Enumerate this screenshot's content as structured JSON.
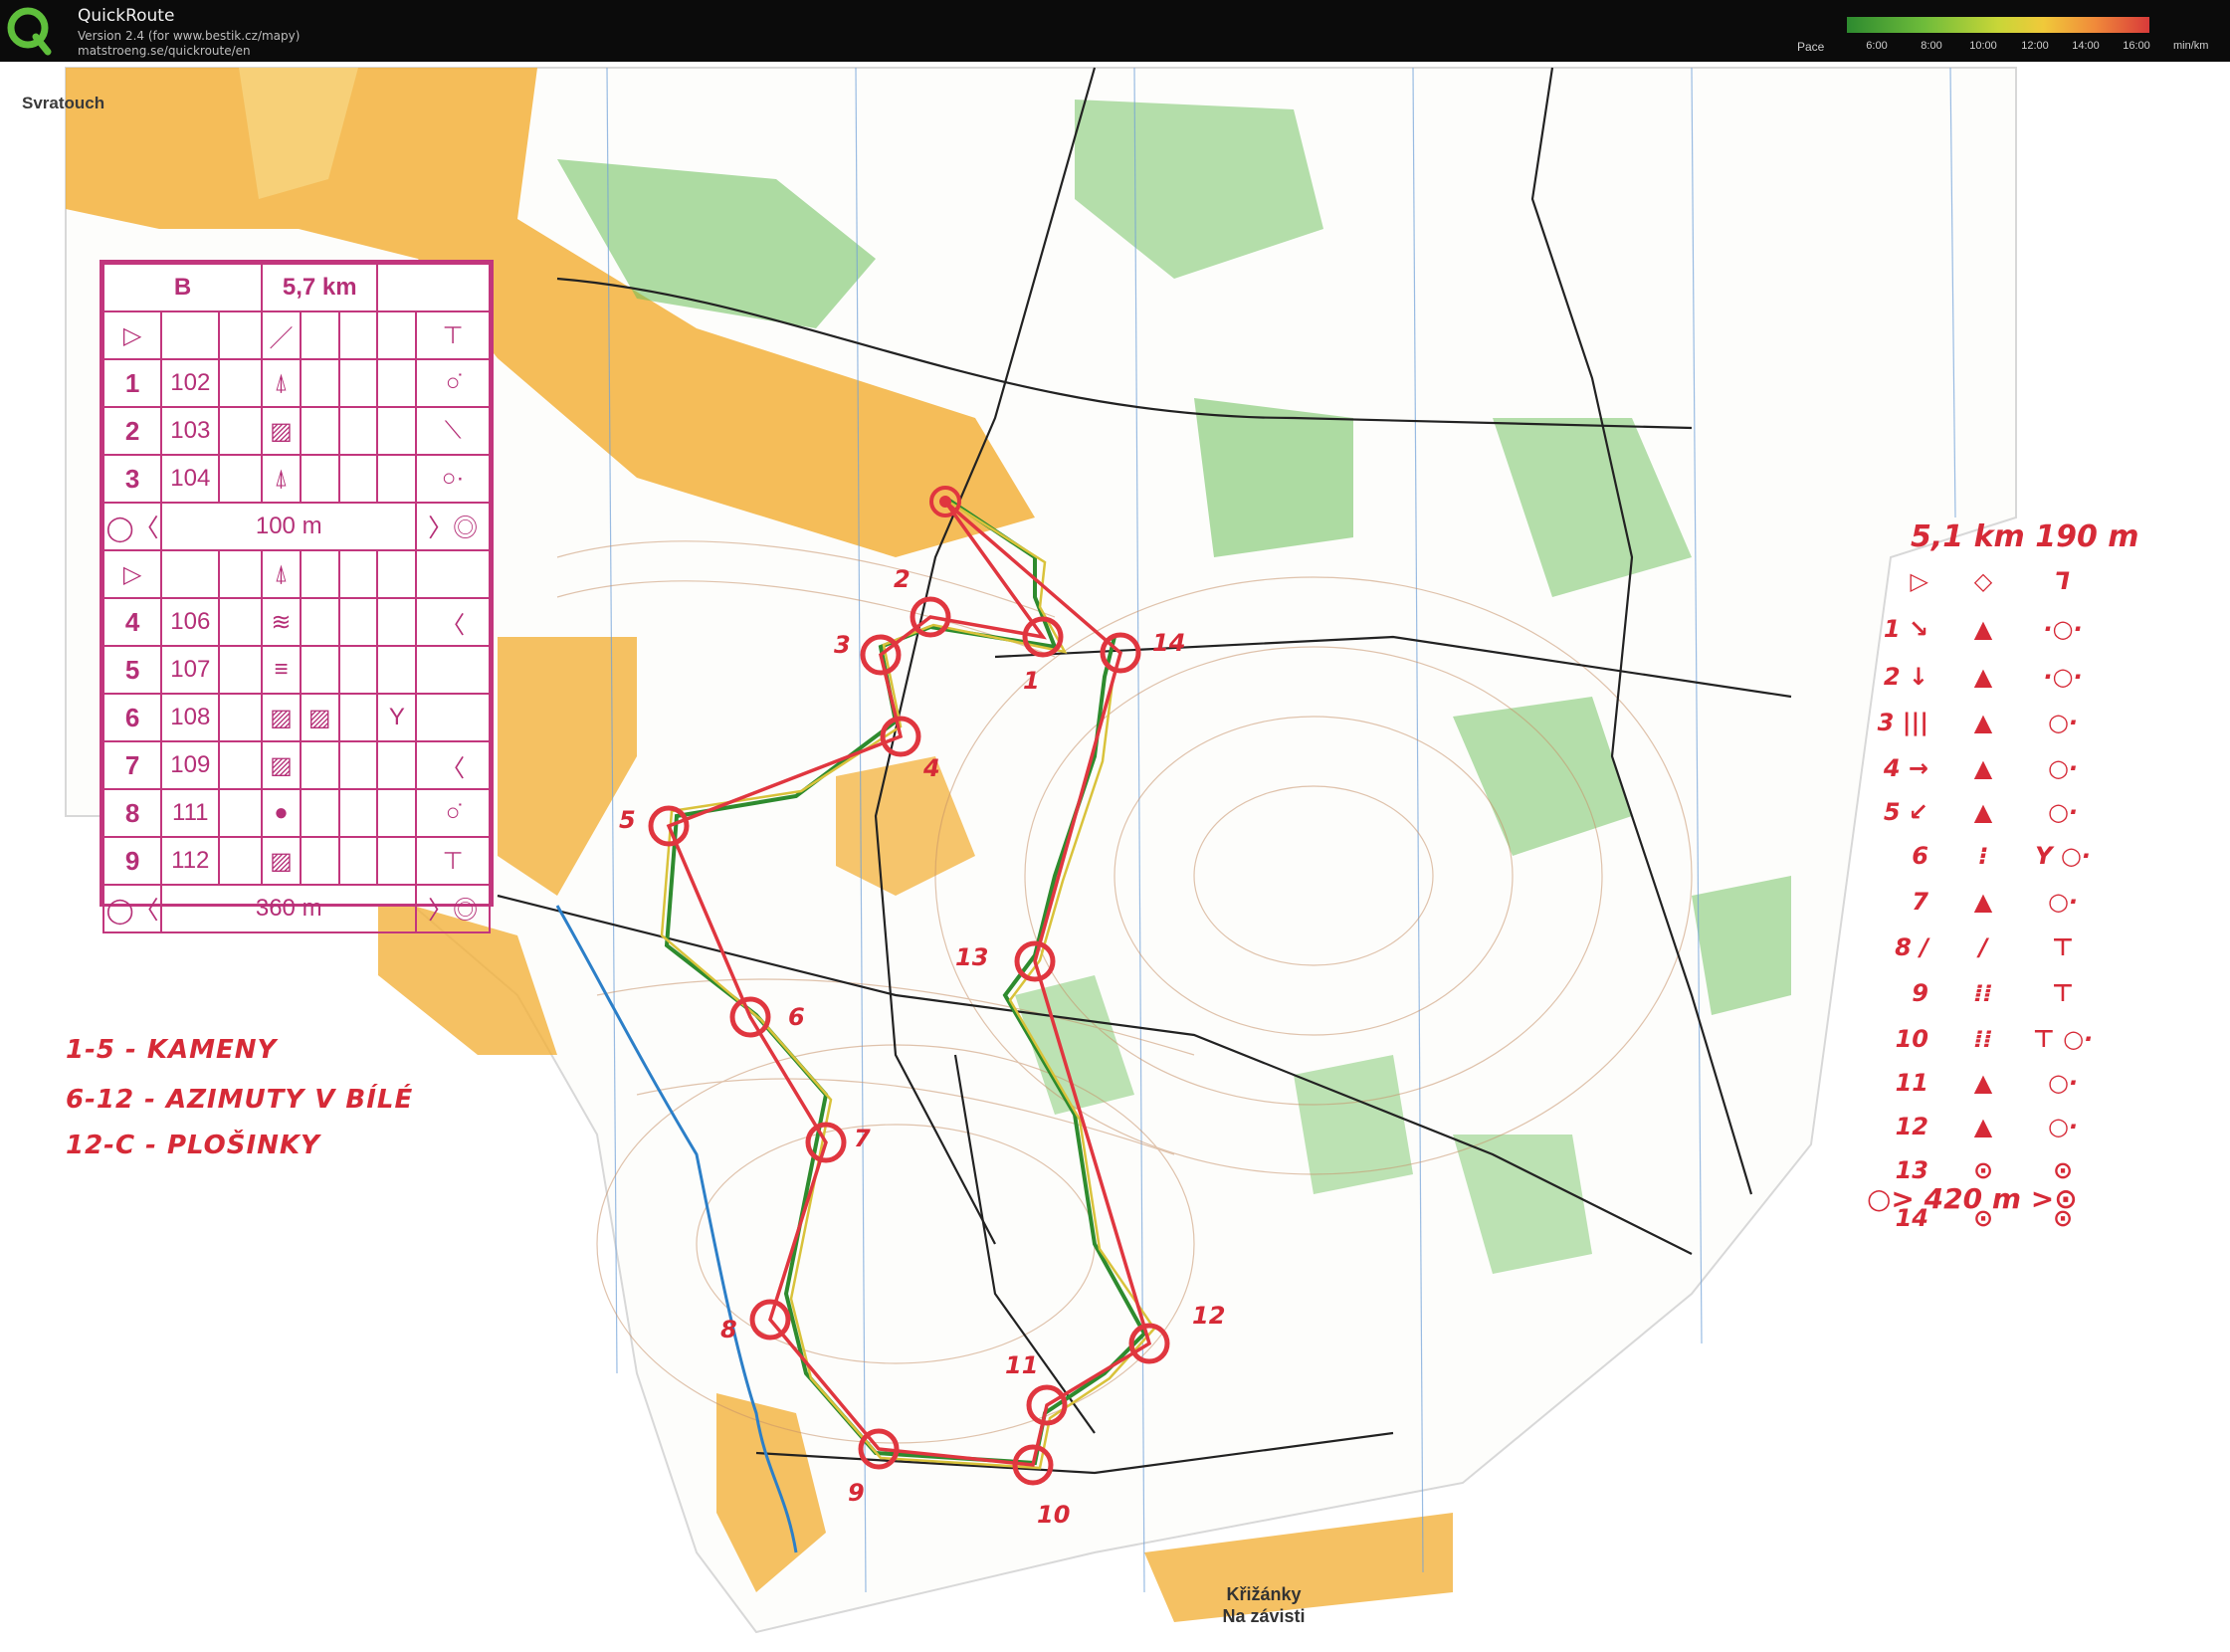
{
  "header": {
    "app_name": "QuickRoute",
    "version": "Version 2.4  (for www.bestik.cz/mapy)",
    "url": "matstroeng.se/quickroute/en",
    "pace_label": "Pace",
    "pace_ticks": [
      "6:00",
      "8:00",
      "10:00",
      "12:00",
      "14:00",
      "16:00"
    ],
    "pace_unit": "min/km",
    "pace_gradient": [
      "#2d8a2f",
      "#6dbb3a",
      "#c8d638",
      "#f0c93a",
      "#f08a3a",
      "#d83a3a"
    ]
  },
  "map": {
    "title": "Svratouch",
    "bottom_label_1": "Křižánky",
    "bottom_label_2": "Na závisti",
    "route_colors": {
      "planned": "#e0363f",
      "gps_green": "#2e8b2e",
      "gps_yellow": "#d9c23a"
    }
  },
  "card": {
    "class": "B",
    "length": "5,7 km",
    "start_symbols": [
      "▷",
      "／",
      "⊤"
    ],
    "rows_a": [
      {
        "num": "1",
        "code": "102",
        "sym1": "⍋",
        "sym3": "○̇"
      },
      {
        "num": "2",
        "code": "103",
        "sym1": "▨",
        "sym3": "⟍"
      },
      {
        "num": "3",
        "code": "104",
        "sym1": "⍋",
        "sym3": "○·"
      }
    ],
    "mid_leg": "100 m",
    "restart_symbols": [
      "▷",
      "⍋"
    ],
    "rows_b": [
      {
        "num": "4",
        "code": "106",
        "sym1": "≋",
        "sym3": "〈"
      },
      {
        "num": "5",
        "code": "107",
        "sym1": "≡",
        "sym3": ""
      },
      {
        "num": "6",
        "code": "108",
        "sym1": "▨",
        "sym2": "▨",
        "sym3": "Y"
      },
      {
        "num": "7",
        "code": "109",
        "sym1": "▨",
        "sym3": "〈"
      },
      {
        "num": "8",
        "code": "111",
        "sym1": "●",
        "sym3": "○̇"
      },
      {
        "num": "9",
        "code": "112",
        "sym1": "▨",
        "sym3": "⊤"
      }
    ],
    "finish_leg": "360 m"
  },
  "notes": {
    "left_1": "1-5 - KAMENY",
    "left_2": "6-12 - AZIMUTY V BÍLÉ",
    "left_3": "12-C - PLOŠINKY",
    "right_header": "5,1 km 190 m",
    "right_rows": [
      {
        "l": "▷",
        "c": "◇",
        "r": "⅂"
      },
      {
        "l": "1 ↘",
        "c": "▲",
        "r": "·○·"
      },
      {
        "l": "2 ↓",
        "c": "▲",
        "r": "·○·"
      },
      {
        "l": "3 |||",
        "c": "▲",
        "r": "○·"
      },
      {
        "l": "4 →",
        "c": "▲",
        "r": "○·"
      },
      {
        "l": "5 ↙",
        "c": "▲",
        "r": "○·"
      },
      {
        "l": "6",
        "c": "⁝",
        "r": "Y ○·"
      },
      {
        "l": "7",
        "c": "▲",
        "r": "○·"
      },
      {
        "l": "8 /",
        "c": "/",
        "r": "⊤"
      },
      {
        "l": "9",
        "c": "⁞⁞",
        "r": "⊤"
      },
      {
        "l": "10",
        "c": "⁞⁞",
        "r": "⊤ ○·"
      },
      {
        "l": "11",
        "c": "▲",
        "r": "○·"
      },
      {
        "l": "12",
        "c": "▲",
        "r": "○·"
      },
      {
        "l": "13",
        "c": "⊙",
        "r": "⊙"
      },
      {
        "l": "14",
        "c": "⊙",
        "r": "⊙"
      }
    ],
    "right_footer": "○> 420 m >⊙",
    "control_numbers": [
      "1",
      "2",
      "3",
      "4",
      "5",
      "6",
      "7",
      "8",
      "9",
      "10",
      "11",
      "12",
      "13",
      "14"
    ]
  }
}
